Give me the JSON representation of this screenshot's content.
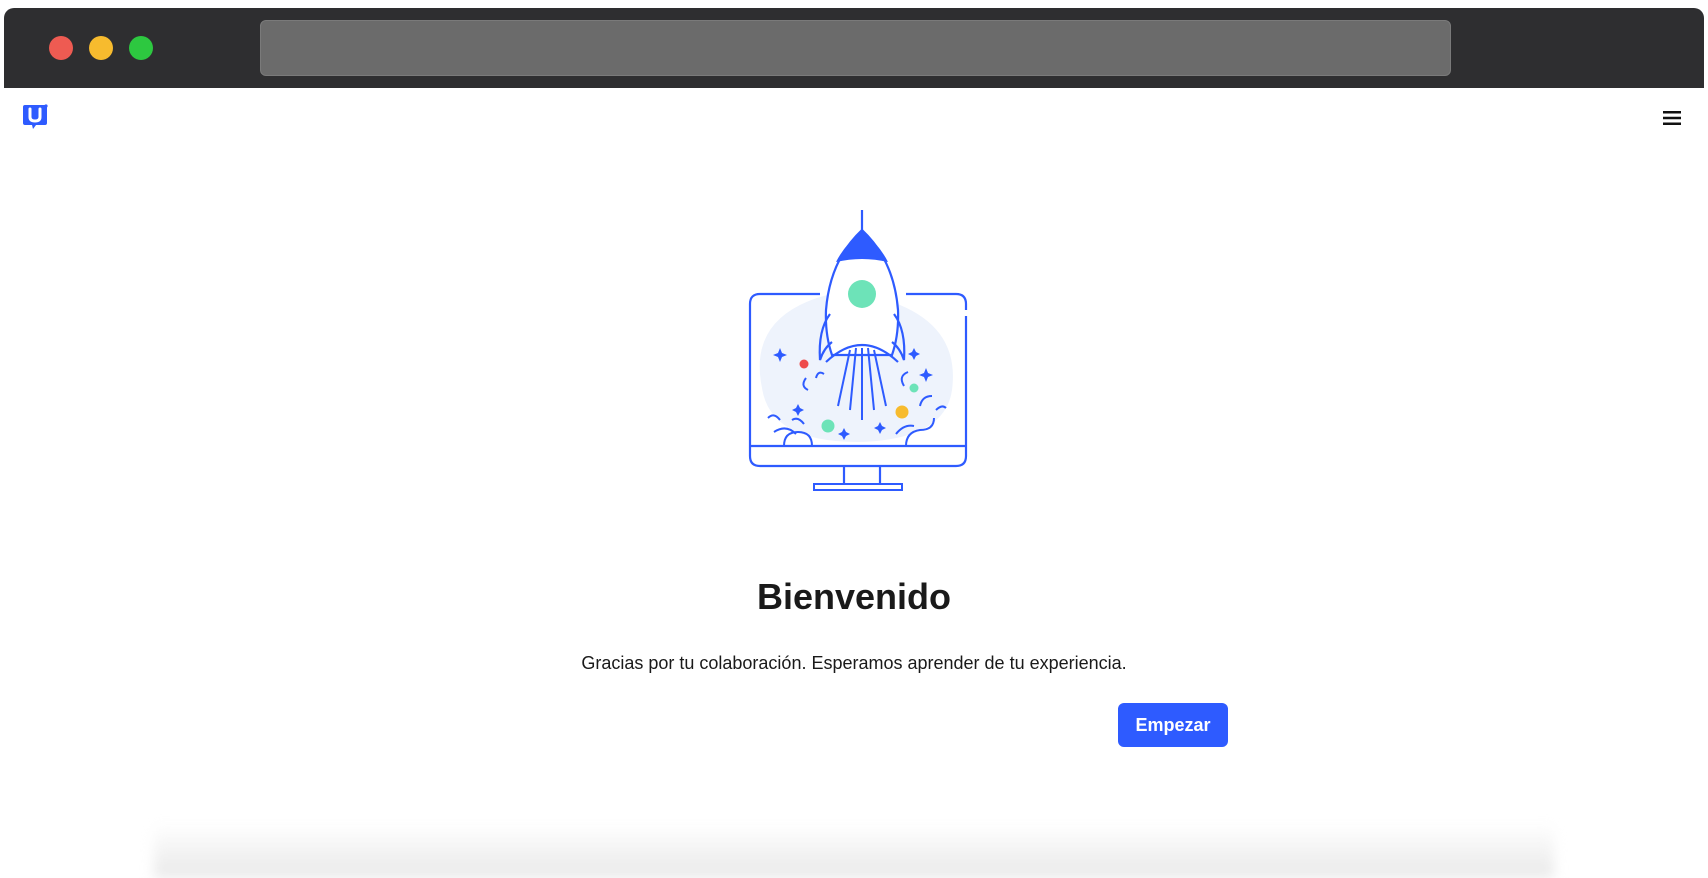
{
  "window": {
    "controls": {
      "close_color": "#ee5b52",
      "minimize_color": "#f7bb2e",
      "maximize_color": "#2dc840"
    }
  },
  "header": {
    "logo_icon": "u-logo-icon",
    "menu_icon": "hamburger-menu-icon",
    "accent_color": "#2e5bff"
  },
  "main": {
    "illustration": "rocket-launch-monitor-illustration",
    "title": "Bienvenido",
    "text": "Gracias por tu colaboración. Esperamos aprender de tu experiencia.",
    "start_button_label": "Empezar"
  }
}
